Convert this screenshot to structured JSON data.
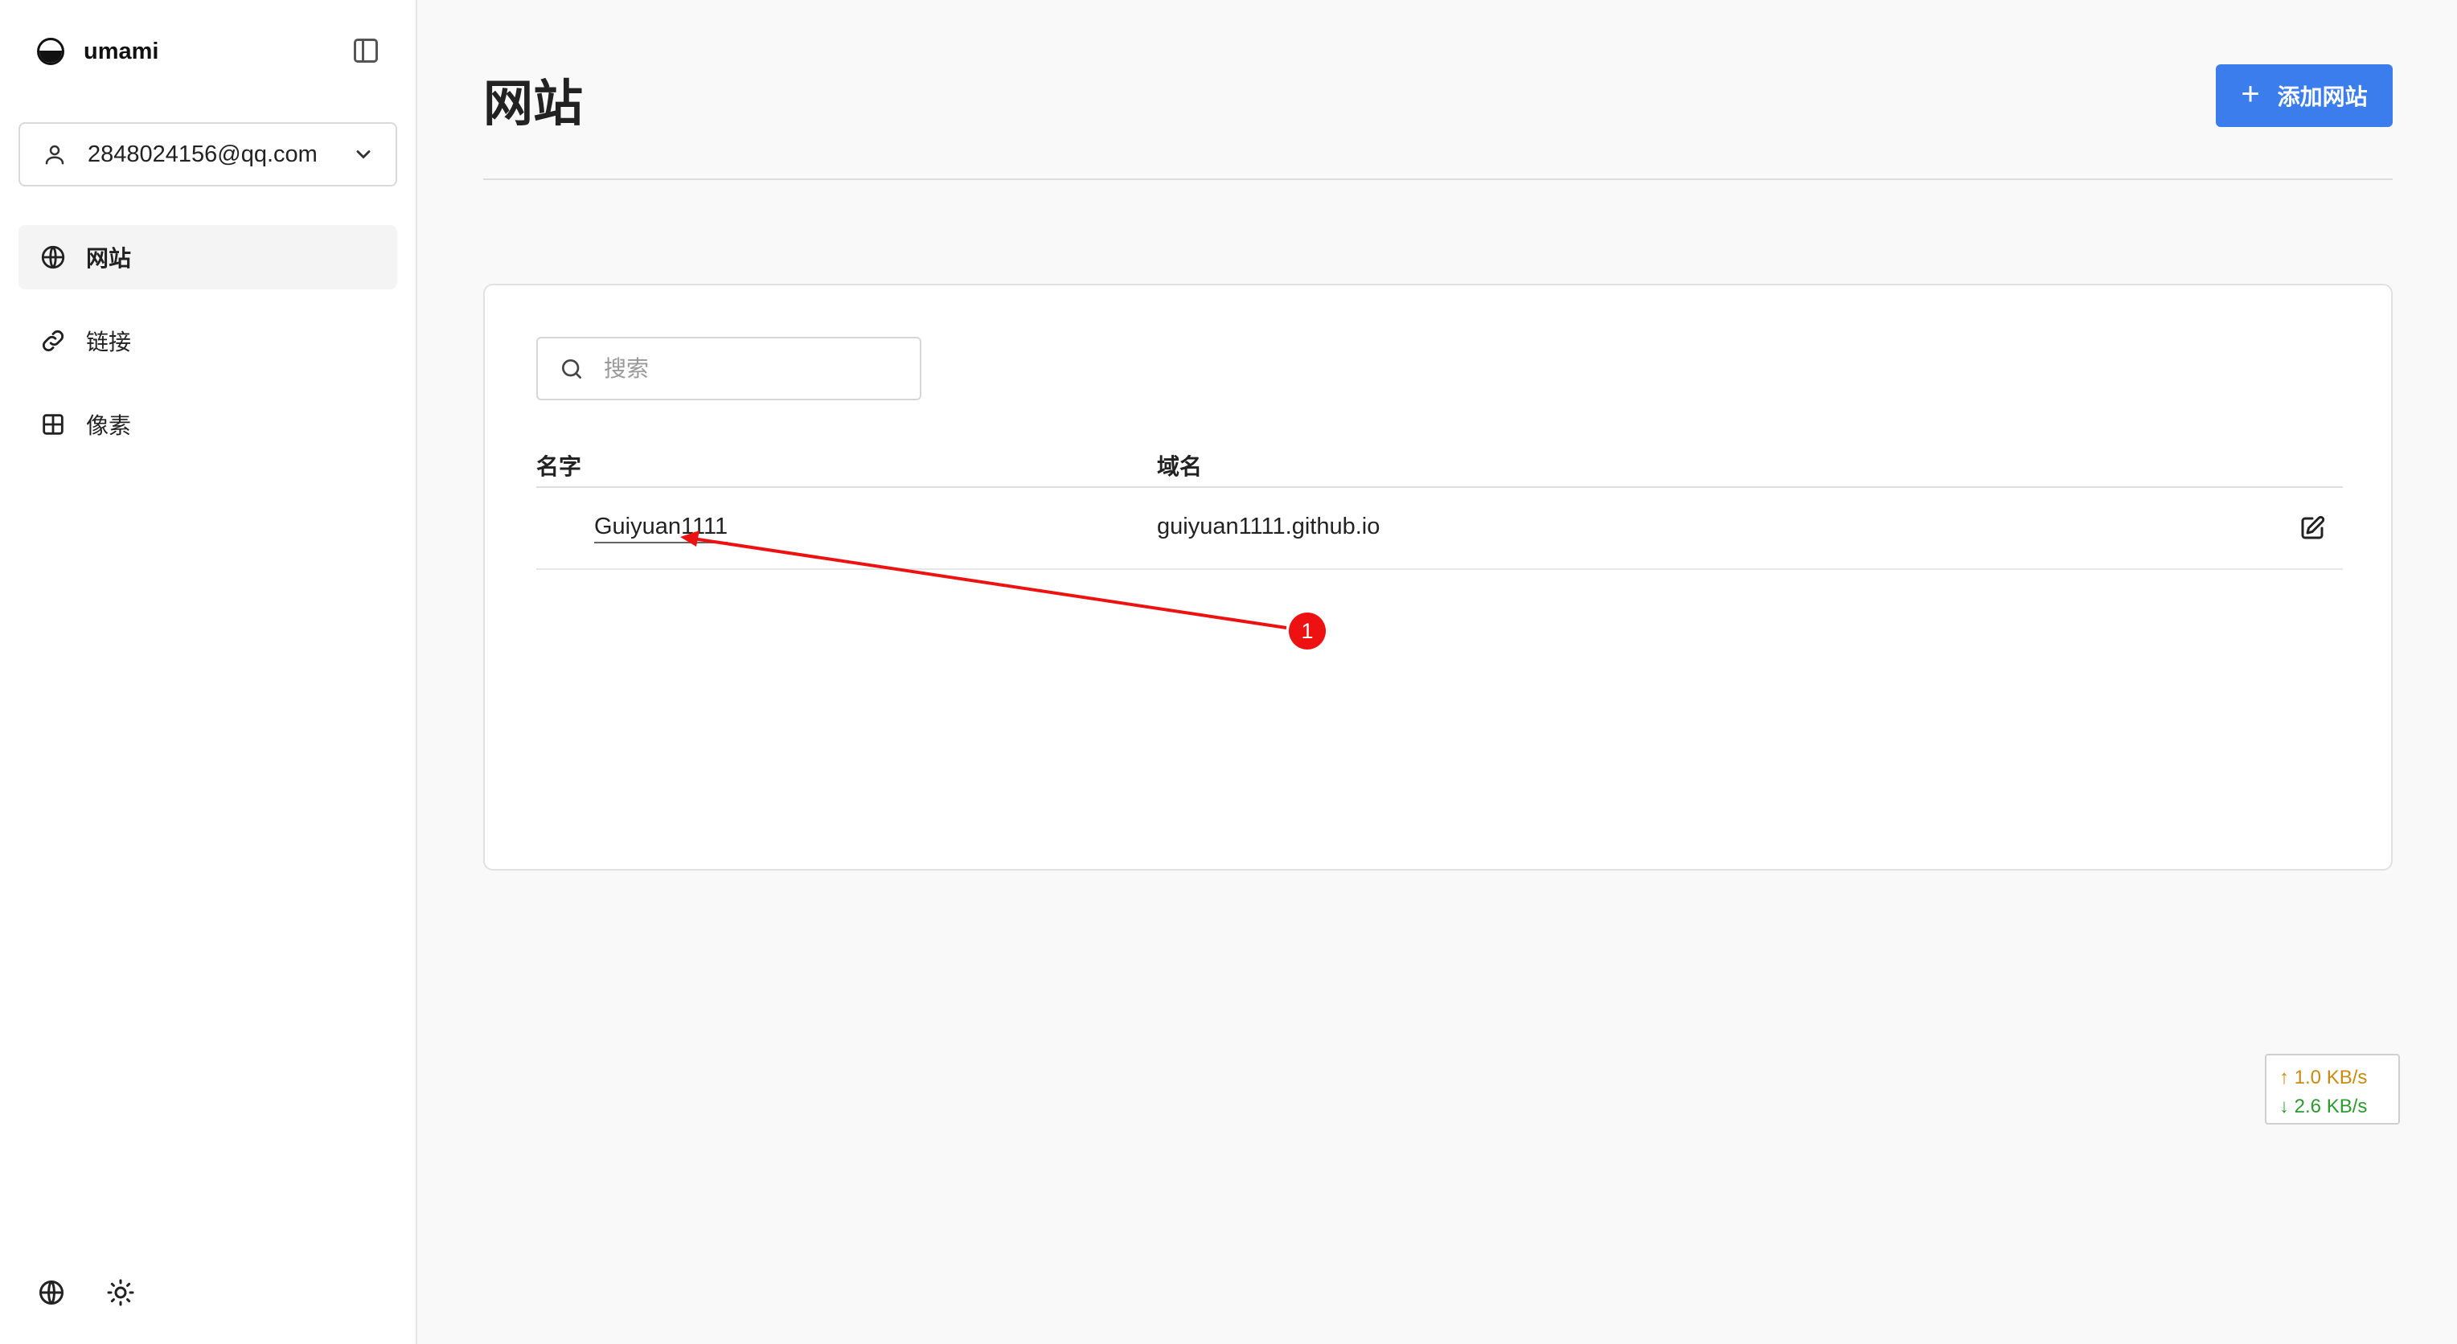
{
  "sidebar": {
    "brand": "umami",
    "account": {
      "email": "2848024156@qq.com"
    },
    "nav": [
      {
        "label": "网站",
        "icon": "globe-icon",
        "active": true
      },
      {
        "label": "链接",
        "icon": "link-icon",
        "active": false
      },
      {
        "label": "像素",
        "icon": "grid-icon",
        "active": false
      }
    ],
    "bottom_icons": [
      "globe-icon",
      "sun-icon"
    ]
  },
  "header": {
    "title": "网站",
    "add_button_label": "添加网站"
  },
  "search": {
    "placeholder": "搜索",
    "value": ""
  },
  "table": {
    "columns": [
      "名字",
      "域名"
    ],
    "rows": [
      {
        "name": "Guiyuan1111",
        "domain": "guiyuan1111.github.io"
      }
    ]
  },
  "annotation": {
    "badge": "1",
    "color": "#ee1111"
  },
  "netspeed": {
    "up": "↑ 1.0 KB/s",
    "down": "↓ 2.6 KB/s"
  },
  "colors": {
    "accent": "#3b7ded",
    "upload": "#c98a10",
    "download": "#2c9a2c"
  }
}
